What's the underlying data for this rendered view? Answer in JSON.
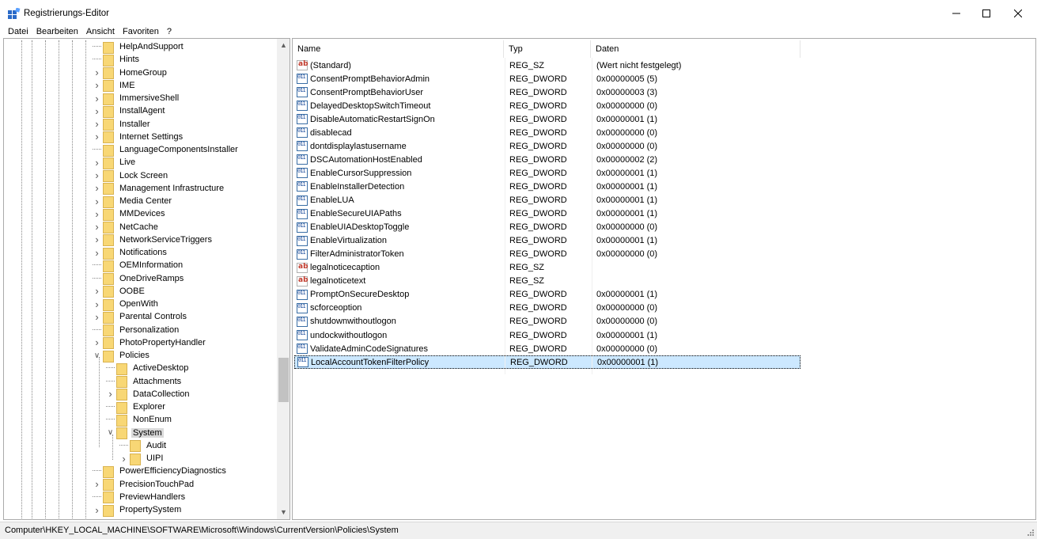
{
  "window": {
    "title": "Registrierungs-Editor"
  },
  "menu": [
    "Datei",
    "Bearbeiten",
    "Ansicht",
    "Favoriten",
    "?"
  ],
  "tree": {
    "items": [
      {
        "label": "HelpAndSupport",
        "depth": 0,
        "expander": "none"
      },
      {
        "label": "Hints",
        "depth": 0,
        "expander": "none"
      },
      {
        "label": "HomeGroup",
        "depth": 0,
        "expander": "collapsed"
      },
      {
        "label": "IME",
        "depth": 0,
        "expander": "collapsed"
      },
      {
        "label": "ImmersiveShell",
        "depth": 0,
        "expander": "collapsed"
      },
      {
        "label": "InstallAgent",
        "depth": 0,
        "expander": "collapsed"
      },
      {
        "label": "Installer",
        "depth": 0,
        "expander": "collapsed"
      },
      {
        "label": "Internet Settings",
        "depth": 0,
        "expander": "collapsed"
      },
      {
        "label": "LanguageComponentsInstaller",
        "depth": 0,
        "expander": "none"
      },
      {
        "label": "Live",
        "depth": 0,
        "expander": "collapsed"
      },
      {
        "label": "Lock Screen",
        "depth": 0,
        "expander": "collapsed"
      },
      {
        "label": "Management Infrastructure",
        "depth": 0,
        "expander": "collapsed"
      },
      {
        "label": "Media Center",
        "depth": 0,
        "expander": "collapsed"
      },
      {
        "label": "MMDevices",
        "depth": 0,
        "expander": "collapsed"
      },
      {
        "label": "NetCache",
        "depth": 0,
        "expander": "collapsed"
      },
      {
        "label": "NetworkServiceTriggers",
        "depth": 0,
        "expander": "collapsed"
      },
      {
        "label": "Notifications",
        "depth": 0,
        "expander": "collapsed"
      },
      {
        "label": "OEMInformation",
        "depth": 0,
        "expander": "none"
      },
      {
        "label": "OneDriveRamps",
        "depth": 0,
        "expander": "none"
      },
      {
        "label": "OOBE",
        "depth": 0,
        "expander": "collapsed"
      },
      {
        "label": "OpenWith",
        "depth": 0,
        "expander": "collapsed"
      },
      {
        "label": "Parental Controls",
        "depth": 0,
        "expander": "collapsed"
      },
      {
        "label": "Personalization",
        "depth": 0,
        "expander": "none"
      },
      {
        "label": "PhotoPropertyHandler",
        "depth": 0,
        "expander": "collapsed"
      },
      {
        "label": "Policies",
        "depth": 0,
        "expander": "expanded"
      },
      {
        "label": "ActiveDesktop",
        "depth": 1,
        "expander": "none"
      },
      {
        "label": "Attachments",
        "depth": 1,
        "expander": "none"
      },
      {
        "label": "DataCollection",
        "depth": 1,
        "expander": "collapsed"
      },
      {
        "label": "Explorer",
        "depth": 1,
        "expander": "none"
      },
      {
        "label": "NonEnum",
        "depth": 1,
        "expander": "none"
      },
      {
        "label": "System",
        "depth": 1,
        "expander": "expanded",
        "selected": true
      },
      {
        "label": "Audit",
        "depth": 2,
        "expander": "none"
      },
      {
        "label": "UIPI",
        "depth": 2,
        "expander": "collapsed"
      },
      {
        "label": "PowerEfficiencyDiagnostics",
        "depth": 0,
        "expander": "none"
      },
      {
        "label": "PrecisionTouchPad",
        "depth": 0,
        "expander": "collapsed"
      },
      {
        "label": "PreviewHandlers",
        "depth": 0,
        "expander": "none"
      },
      {
        "label": "PropertySystem",
        "depth": 0,
        "expander": "collapsed"
      }
    ]
  },
  "columns": {
    "name": "Name",
    "type": "Typ",
    "data": "Daten"
  },
  "values": [
    {
      "name": "(Standard)",
      "type": "REG_SZ",
      "data": "(Wert nicht festgelegt)",
      "icon": "string-value-icon"
    },
    {
      "name": "ConsentPromptBehaviorAdmin",
      "type": "REG_DWORD",
      "data": "0x00000005 (5)",
      "icon": "binary-value-icon"
    },
    {
      "name": "ConsentPromptBehaviorUser",
      "type": "REG_DWORD",
      "data": "0x00000003 (3)",
      "icon": "binary-value-icon"
    },
    {
      "name": "DelayedDesktopSwitchTimeout",
      "type": "REG_DWORD",
      "data": "0x00000000 (0)",
      "icon": "binary-value-icon"
    },
    {
      "name": "DisableAutomaticRestartSignOn",
      "type": "REG_DWORD",
      "data": "0x00000001 (1)",
      "icon": "binary-value-icon"
    },
    {
      "name": "disablecad",
      "type": "REG_DWORD",
      "data": "0x00000000 (0)",
      "icon": "binary-value-icon"
    },
    {
      "name": "dontdisplaylastusername",
      "type": "REG_DWORD",
      "data": "0x00000000 (0)",
      "icon": "binary-value-icon"
    },
    {
      "name": "DSCAutomationHostEnabled",
      "type": "REG_DWORD",
      "data": "0x00000002 (2)",
      "icon": "binary-value-icon"
    },
    {
      "name": "EnableCursorSuppression",
      "type": "REG_DWORD",
      "data": "0x00000001 (1)",
      "icon": "binary-value-icon"
    },
    {
      "name": "EnableInstallerDetection",
      "type": "REG_DWORD",
      "data": "0x00000001 (1)",
      "icon": "binary-value-icon"
    },
    {
      "name": "EnableLUA",
      "type": "REG_DWORD",
      "data": "0x00000001 (1)",
      "icon": "binary-value-icon"
    },
    {
      "name": "EnableSecureUIAPaths",
      "type": "REG_DWORD",
      "data": "0x00000001 (1)",
      "icon": "binary-value-icon"
    },
    {
      "name": "EnableUIADesktopToggle",
      "type": "REG_DWORD",
      "data": "0x00000000 (0)",
      "icon": "binary-value-icon"
    },
    {
      "name": "EnableVirtualization",
      "type": "REG_DWORD",
      "data": "0x00000001 (1)",
      "icon": "binary-value-icon"
    },
    {
      "name": "FilterAdministratorToken",
      "type": "REG_DWORD",
      "data": "0x00000000 (0)",
      "icon": "binary-value-icon"
    },
    {
      "name": "legalnoticecaption",
      "type": "REG_SZ",
      "data": "",
      "icon": "string-value-icon"
    },
    {
      "name": "legalnoticetext",
      "type": "REG_SZ",
      "data": "",
      "icon": "string-value-icon"
    },
    {
      "name": "PromptOnSecureDesktop",
      "type": "REG_DWORD",
      "data": "0x00000001 (1)",
      "icon": "binary-value-icon"
    },
    {
      "name": "scforceoption",
      "type": "REG_DWORD",
      "data": "0x00000000 (0)",
      "icon": "binary-value-icon"
    },
    {
      "name": "shutdownwithoutlogon",
      "type": "REG_DWORD",
      "data": "0x00000000 (0)",
      "icon": "binary-value-icon"
    },
    {
      "name": "undockwithoutlogon",
      "type": "REG_DWORD",
      "data": "0x00000001 (1)",
      "icon": "binary-value-icon"
    },
    {
      "name": "ValidateAdminCodeSignatures",
      "type": "REG_DWORD",
      "data": "0x00000000 (0)",
      "icon": "binary-value-icon"
    },
    {
      "name": "LocalAccountTokenFilterPolicy",
      "type": "REG_DWORD",
      "data": "0x00000001 (1)",
      "icon": "binary-value-icon",
      "selected": true
    }
  ],
  "status": {
    "path": "Computer\\HKEY_LOCAL_MACHINE\\SOFTWARE\\Microsoft\\Windows\\CurrentVersion\\Policies\\System"
  },
  "icons": {
    "app": "registry-editor-icon",
    "folder": "folder-icon",
    "string_glyph": "ab",
    "binary_glyph": "011"
  },
  "colors": {
    "selection": "#cce8ff",
    "folder": "#f8d775",
    "tree_selection": "#d9d9d9"
  }
}
